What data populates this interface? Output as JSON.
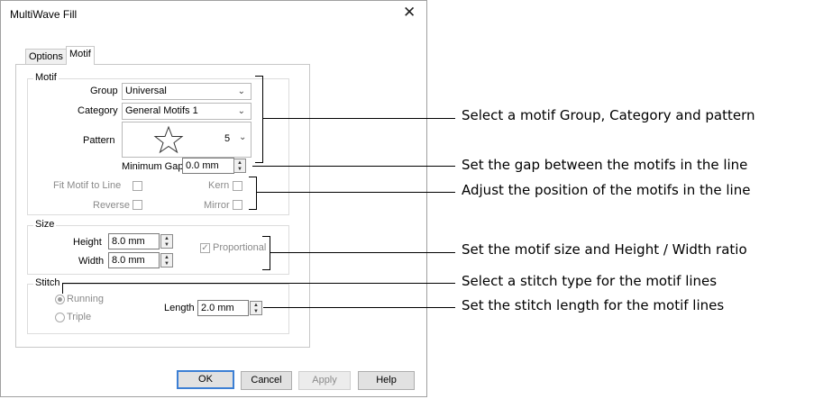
{
  "dialog": {
    "title": "MultiWave Fill",
    "close_symbol": "✕",
    "tabs": [
      {
        "label": "Options"
      },
      {
        "label": "Motif"
      }
    ],
    "motif_group": {
      "title": "Motif",
      "group_label": "Group",
      "group_value": "Universal",
      "category_label": "Category",
      "category_value": "General Motifs 1",
      "pattern_label": "Pattern",
      "pattern_number": "5",
      "minimum_gap_label": "Minimum Gap",
      "minimum_gap_value": "0.0 mm",
      "fit_motif_label": "Fit Motif to Line",
      "kern_label": "Kern",
      "reverse_label": "Reverse",
      "mirror_label": "Mirror"
    },
    "size_group": {
      "title": "Size",
      "height_label": "Height",
      "height_value": "8.0 mm",
      "width_label": "Width",
      "width_value": "8.0 mm",
      "proportional_label": "Proportional",
      "proportional_checked": true
    },
    "stitch_group": {
      "title": "Stitch",
      "running_label": "Running",
      "triple_label": "Triple",
      "selected": "Running",
      "length_label": "Length",
      "length_value": "2.0 mm"
    },
    "buttons": {
      "ok": "OK",
      "cancel": "Cancel",
      "apply": "Apply",
      "help": "Help"
    }
  },
  "callouts": {
    "motif": "Select a motif Group, Category and pattern",
    "gap": "Set the gap between the motifs in the line",
    "position": "Adjust the position of the motifs in the line",
    "size": "Set the motif size and Height / Width ratio",
    "stitch_type": "Select a stitch type for the motif lines",
    "stitch_length": "Set the stitch length for the motif lines"
  },
  "colors": {
    "accent": "#3c7fd4",
    "disabled_text": "#8a8a8a"
  }
}
